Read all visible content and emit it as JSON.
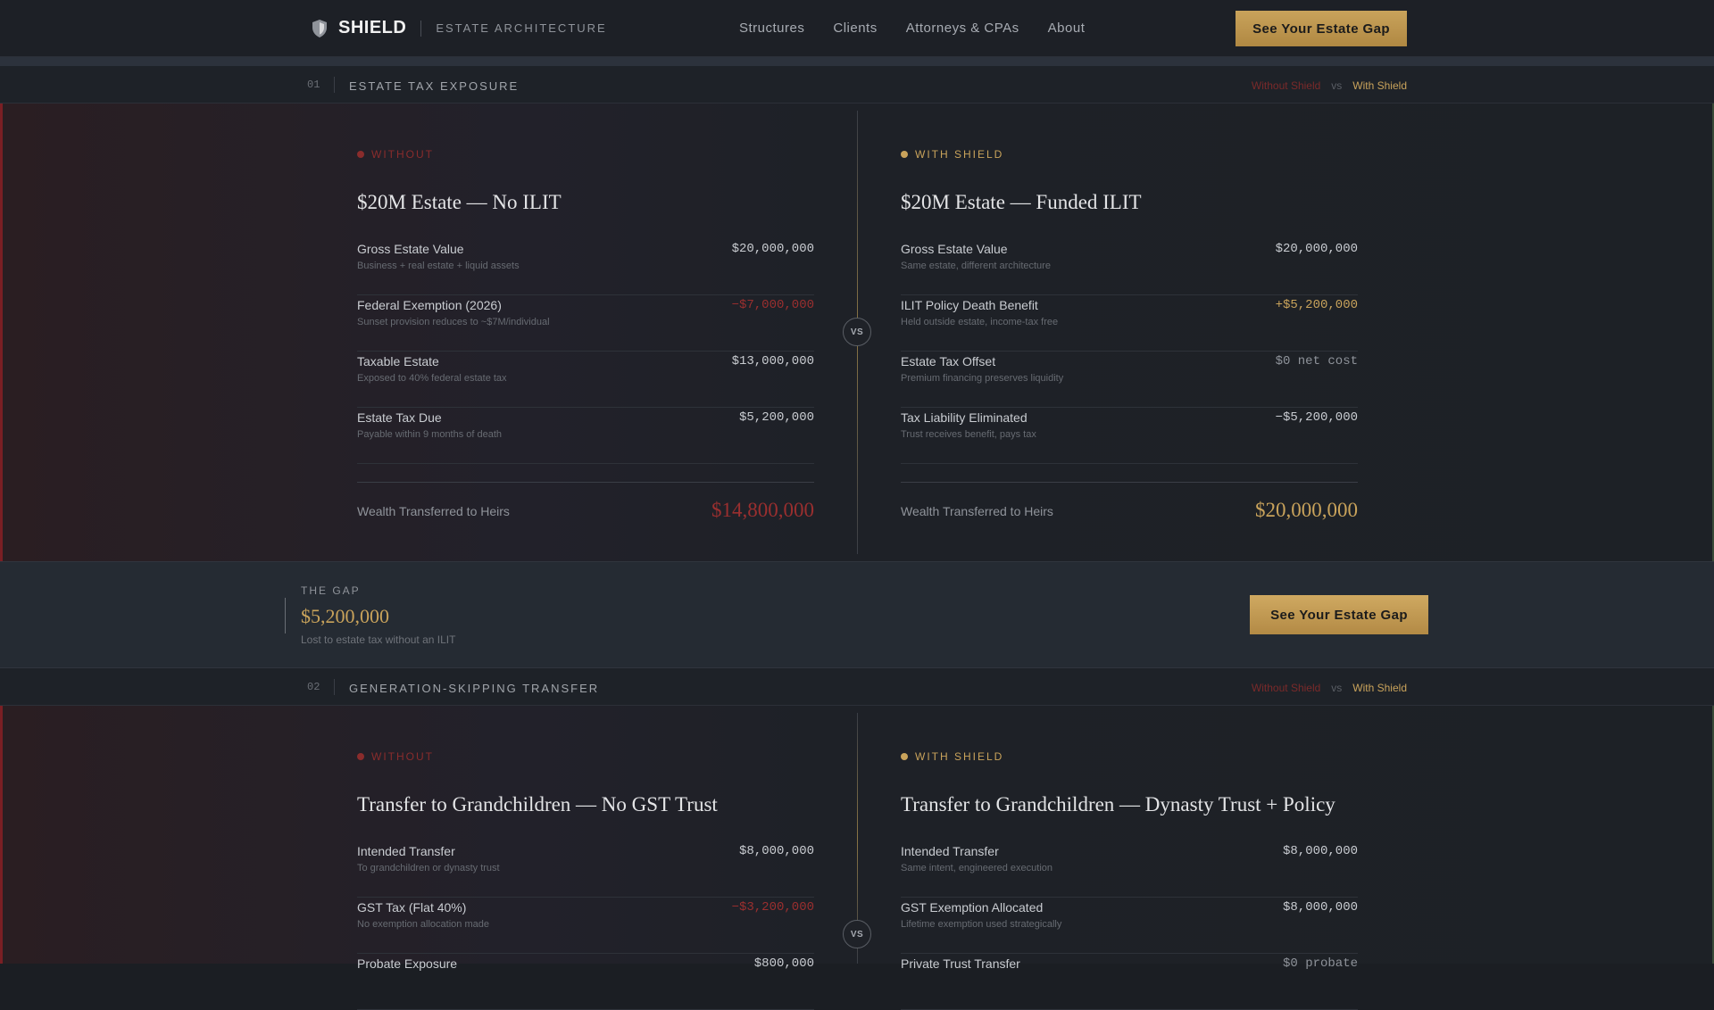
{
  "nav": {
    "brand": "SHIELD",
    "tagline": "ESTATE ARCHITECTURE",
    "links": [
      "Structures",
      "Clients",
      "Attorneys & CPAs",
      "About"
    ],
    "cta": "See Your Estate Gap"
  },
  "sections": [
    {
      "number": "01",
      "title": "ESTATE TAX EXPOSURE",
      "legend": {
        "without": "Without Shield",
        "vs": "vs",
        "with": "With Shield"
      },
      "vs_label": "VS",
      "without": {
        "tag": "WITHOUT",
        "title": "$20M Estate — No ILIT",
        "rows": [
          {
            "label": "Gross Estate Value",
            "sub": "Business + real estate + liquid assets",
            "value": "$20,000,000"
          },
          {
            "label": "Federal Exemption (2026)",
            "sub": "Sunset provision reduces to ~$7M/individual",
            "value": "−$7,000,000"
          },
          {
            "label": "Taxable Estate",
            "sub": "Exposed to 40% federal estate tax",
            "value": "$13,000,000"
          },
          {
            "label": "Estate Tax Due",
            "sub": "Payable within 9 months of death",
            "value": "$5,200,000"
          }
        ],
        "total_label": "Wealth Transferred to Heirs",
        "total_value": "$14,800,000"
      },
      "with": {
        "tag": "WITH SHIELD",
        "title": "$20M Estate — Funded ILIT",
        "rows": [
          {
            "label": "Gross Estate Value",
            "sub": "Same estate, different architecture",
            "value": "$20,000,000"
          },
          {
            "label": "ILIT Policy Death Benefit",
            "sub": "Held outside estate, income-tax free",
            "value": "+$5,200,000"
          },
          {
            "label": "Estate Tax Offset",
            "sub": "Premium financing preserves liquidity",
            "value": "$0 net cost"
          },
          {
            "label": "Tax Liability Eliminated",
            "sub": "Trust receives benefit, pays tax",
            "value": "−$5,200,000"
          }
        ],
        "total_label": "Wealth Transferred to Heirs",
        "total_value": "$20,000,000"
      }
    },
    {
      "number": "02",
      "title": "GENERATION-SKIPPING TRANSFER",
      "legend": {
        "without": "Without Shield",
        "vs": "vs",
        "with": "With Shield"
      },
      "vs_label": "VS",
      "without": {
        "tag": "WITHOUT",
        "title": "Transfer to Grandchildren — No GST Trust",
        "rows": [
          {
            "label": "Intended Transfer",
            "sub": "To grandchildren or dynasty trust",
            "value": "$8,000,000"
          },
          {
            "label": "GST Tax (Flat 40%)",
            "sub": "No exemption allocation made",
            "value": "−$3,200,000"
          },
          {
            "label": "Probate Exposure",
            "sub": "",
            "value": "$800,000"
          }
        ]
      },
      "with": {
        "tag": "WITH SHIELD",
        "title": "Transfer to Grandchildren — Dynasty Trust + Policy",
        "rows": [
          {
            "label": "Intended Transfer",
            "sub": "Same intent, engineered execution",
            "value": "$8,000,000"
          },
          {
            "label": "GST Exemption Allocated",
            "sub": "Lifetime exemption used strategically",
            "value": "$8,000,000"
          },
          {
            "label": "Private Trust Transfer",
            "sub": "",
            "value": "$0 probate"
          }
        ]
      }
    }
  ],
  "gap": {
    "label": "THE GAP",
    "value": "$5,200,000",
    "sub": "Lost to estate tax without an ILIT",
    "cta": "See Your Estate Gap"
  },
  "colors": {
    "gold": "#c9a35b",
    "red": "#9a2f2f",
    "background": "#1b1e23"
  }
}
